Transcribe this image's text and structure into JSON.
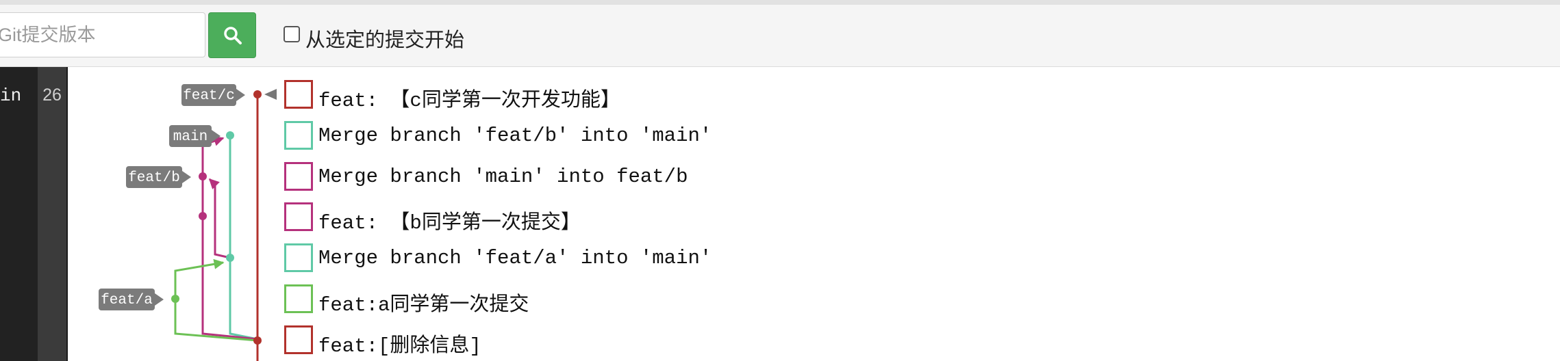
{
  "toolbar": {
    "search_placeholder": "Git提交版本",
    "search_icon": "search-icon",
    "filter_label": "从选定的提交开始",
    "filter_checked": false
  },
  "left_panel": {
    "text": "in"
  },
  "count_panel": {
    "count": "26"
  },
  "branch_tags": {
    "feat_c": "feat/c",
    "main": "main",
    "feat_b": "feat/b",
    "feat_a": "feat/a"
  },
  "commits": [
    {
      "message": "feat: 【c同学第一次开发功能】",
      "color": "#b2322c"
    },
    {
      "message": "Merge branch 'feat/b' into 'main'",
      "color": "#5fc9a6"
    },
    {
      "message": "Merge branch 'main' into feat/b",
      "color": "#b5317c"
    },
    {
      "message": "feat: 【b同学第一次提交】",
      "color": "#b5317c"
    },
    {
      "message": "Merge branch 'feat/a' into 'main'",
      "color": "#5fc9a6"
    },
    {
      "message": "feat:a同学第一次提交",
      "color": "#6cc155"
    },
    {
      "message": "feat:[删除信息]",
      "color": "#b2322c"
    }
  ],
  "colors": {
    "feat_c_branch": "#b2322c",
    "main_branch": "#5fc9a6",
    "feat_b_branch": "#b5317c",
    "feat_a_branch": "#6cc155",
    "tag_background": "#7b7b7b",
    "search_button": "#4cae5b"
  }
}
